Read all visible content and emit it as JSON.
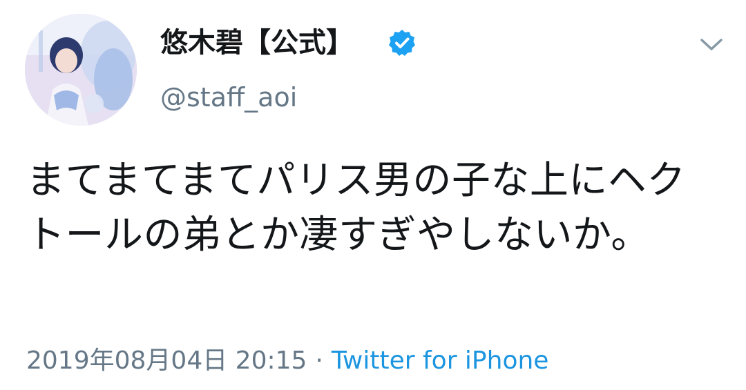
{
  "user": {
    "display_name": "悠木碧【公式】",
    "handle": "@staff_aoi",
    "verified": true,
    "avatar_icon": "profile-photo"
  },
  "menu": {
    "icon": "chevron-down-icon"
  },
  "tweet": {
    "text": "まてまてまてパリス男の子な上にヘクトールの弟とか凄すぎやしないか。"
  },
  "meta": {
    "timestamp": "2019年08月04日 20:15",
    "separator": "·",
    "source": "Twitter for iPhone"
  },
  "colors": {
    "text": "#14171a",
    "secondary": "#657786",
    "link": "#1b95e0",
    "verified_badge": "#1da1f2"
  }
}
